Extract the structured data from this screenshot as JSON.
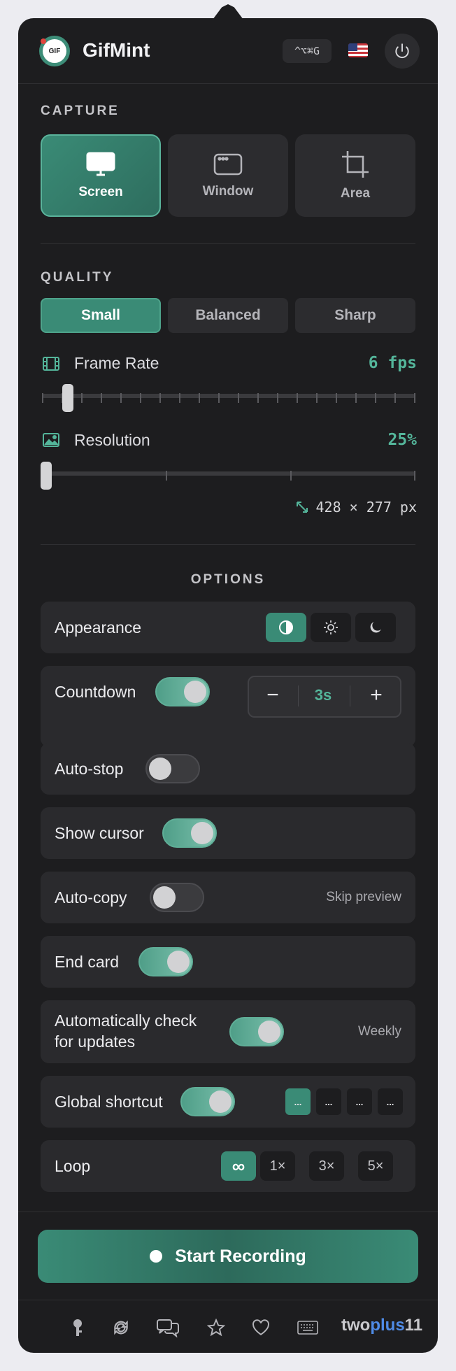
{
  "header": {
    "logo_text": "GIF",
    "app_name": "GifMint",
    "shortcut": "^⌥⌘G",
    "language_flag": "us-flag-icon",
    "power_icon": "power-icon"
  },
  "capture": {
    "section_label": "CAPTURE",
    "modes": [
      {
        "label": "Screen",
        "icon": "monitor-icon",
        "selected": true
      },
      {
        "label": "Window",
        "icon": "window-icon",
        "selected": false
      },
      {
        "label": "Area",
        "icon": "crop-icon",
        "selected": false
      }
    ]
  },
  "quality": {
    "section_label": "QUALITY",
    "presets": [
      {
        "label": "Small",
        "selected": true
      },
      {
        "label": "Balanced",
        "selected": false
      },
      {
        "label": "Sharp",
        "selected": false
      }
    ],
    "frame_rate": {
      "label": "Frame Rate",
      "value": "6 fps",
      "icon": "film-icon",
      "level": 0.06
    },
    "resolution": {
      "label": "Resolution",
      "value": "25%",
      "icon": "image-icon",
      "level": 0.0
    },
    "dimensions": {
      "text": "428 × 277 px",
      "icon": "resize-arrows-icon"
    }
  },
  "options": {
    "section_label": "OPTIONS",
    "appearance": {
      "label": "Appearance",
      "modes": [
        "auto-contrast-icon",
        "sun-icon",
        "moon-icon"
      ],
      "selected": 0
    },
    "countdown": {
      "label": "Countdown",
      "enabled": true,
      "minus": "−",
      "value": "3s",
      "plus": "+"
    },
    "auto_stop": {
      "label": "Auto-stop",
      "enabled": false
    },
    "show_cursor": {
      "label": "Show cursor",
      "enabled": true
    },
    "auto_copy": {
      "label": "Auto-copy",
      "enabled": false,
      "note": "Skip preview"
    },
    "end_card": {
      "label": "End card",
      "enabled": true
    },
    "auto_update": {
      "label_line1": "Automatically check",
      "label_line2": "for updates",
      "enabled": true,
      "note": "Weekly"
    },
    "global_shortcut": {
      "label": "Global shortcut",
      "enabled": true,
      "slots": [
        "...",
        "...",
        "...",
        "..."
      ],
      "selected": 0
    },
    "loop": {
      "label": "Loop",
      "choices": [
        "∞",
        "1×",
        "3×",
        "5×"
      ],
      "selected": 0
    }
  },
  "start_button": {
    "label": "Start Recording"
  },
  "footer": {
    "icons": [
      "key-icon",
      "refresh-icon",
      "chat-icon",
      "star-icon",
      "heart-icon",
      "keyboard-icon"
    ],
    "brand_part1": "two",
    "brand_part2": "plus",
    "brand_part3": "11"
  },
  "colors": {
    "accent": "#3a8b76",
    "accent_text": "#54b59a",
    "panel": "#1d1d1f",
    "card": "#2a2a2d",
    "brand_blue": "#4f8be6"
  }
}
